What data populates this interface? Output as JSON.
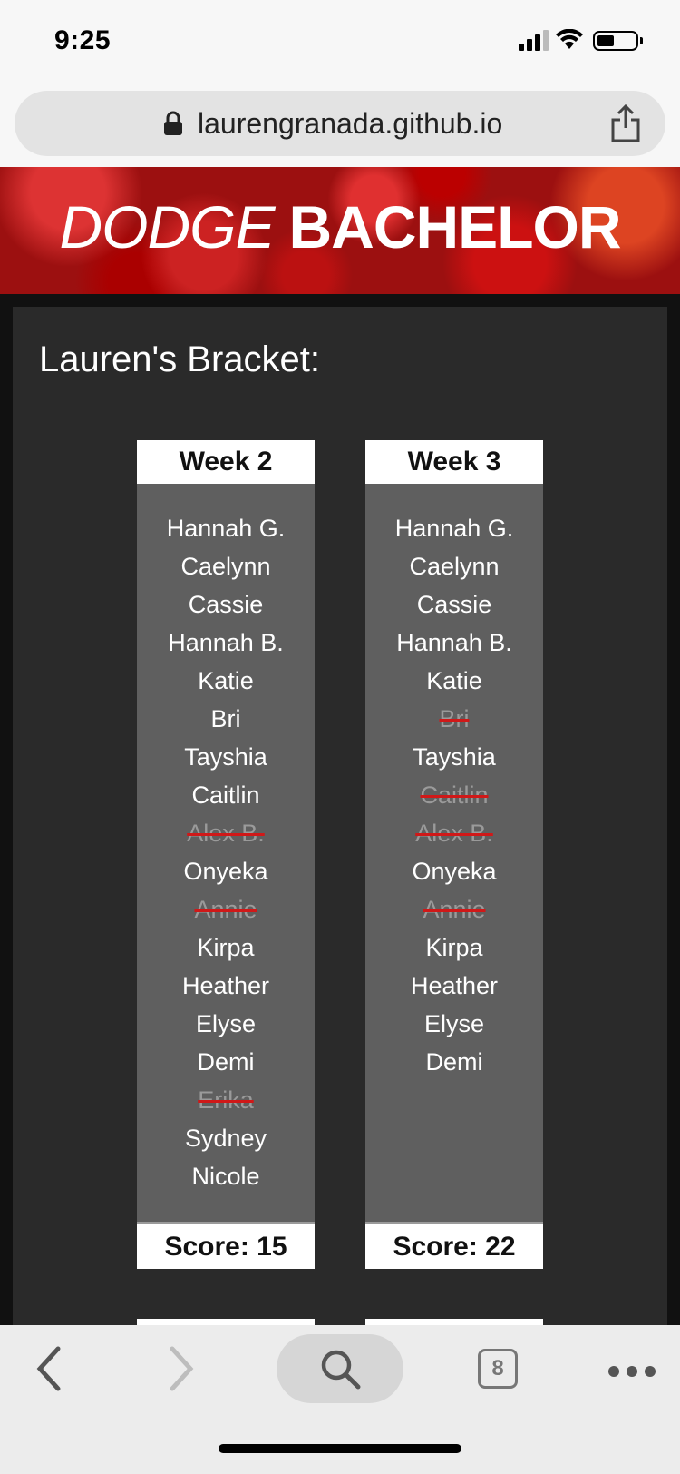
{
  "status": {
    "time": "9:25"
  },
  "browser": {
    "url": "laurengranada.github.io",
    "tab_count": "8"
  },
  "banner": {
    "title_light": "DODGE",
    "title_bold": "BACHELOR"
  },
  "bracket": {
    "heading": "Lauren's Bracket:",
    "weeks": [
      {
        "label": "Week 2",
        "score": "Score: 15",
        "contestants": [
          {
            "name": "Hannah G.",
            "eliminated": false
          },
          {
            "name": "Caelynn",
            "eliminated": false
          },
          {
            "name": "Cassie",
            "eliminated": false
          },
          {
            "name": "Hannah B.",
            "eliminated": false
          },
          {
            "name": "Katie",
            "eliminated": false
          },
          {
            "name": "Bri",
            "eliminated": false
          },
          {
            "name": "Tayshia",
            "eliminated": false
          },
          {
            "name": "Caitlin",
            "eliminated": false
          },
          {
            "name": "Alex B.",
            "eliminated": true
          },
          {
            "name": "Onyeka",
            "eliminated": false
          },
          {
            "name": "Annie",
            "eliminated": true
          },
          {
            "name": "Kirpa",
            "eliminated": false
          },
          {
            "name": "Heather",
            "eliminated": false
          },
          {
            "name": "Elyse",
            "eliminated": false
          },
          {
            "name": "Demi",
            "eliminated": false
          },
          {
            "name": "Erika",
            "eliminated": true
          },
          {
            "name": "Sydney",
            "eliminated": false
          },
          {
            "name": "Nicole",
            "eliminated": false
          }
        ]
      },
      {
        "label": "Week 3",
        "score": "Score: 22",
        "contestants": [
          {
            "name": "Hannah G.",
            "eliminated": false
          },
          {
            "name": "Caelynn",
            "eliminated": false
          },
          {
            "name": "Cassie",
            "eliminated": false
          },
          {
            "name": "Hannah B.",
            "eliminated": false
          },
          {
            "name": "Katie",
            "eliminated": false
          },
          {
            "name": "Bri",
            "eliminated": true
          },
          {
            "name": "Tayshia",
            "eliminated": false
          },
          {
            "name": "Caitlin",
            "eliminated": true
          },
          {
            "name": "Alex B.",
            "eliminated": true
          },
          {
            "name": "Onyeka",
            "eliminated": false
          },
          {
            "name": "Annie",
            "eliminated": true
          },
          {
            "name": "Kirpa",
            "eliminated": false
          },
          {
            "name": "Heather",
            "eliminated": false
          },
          {
            "name": "Elyse",
            "eliminated": false
          },
          {
            "name": "Demi",
            "eliminated": false
          }
        ]
      }
    ]
  },
  "colors": {
    "banner_red": "#9c1010",
    "panel": "#2a2a2a",
    "column": "#5f5f5f",
    "strike": "#d01818"
  }
}
